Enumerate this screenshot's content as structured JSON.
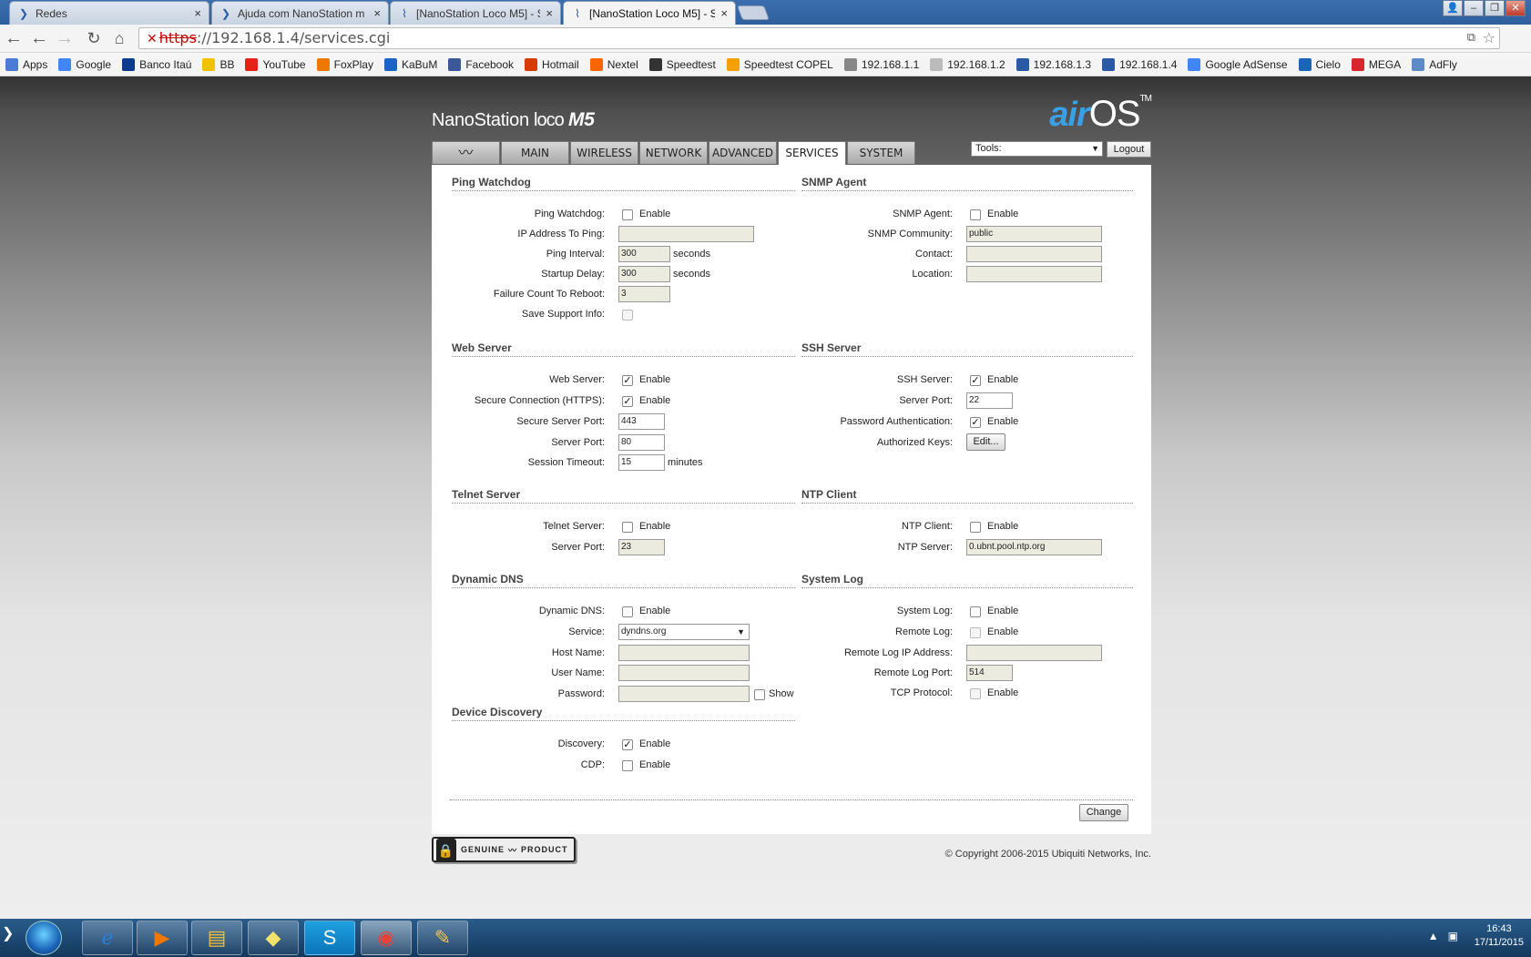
{
  "browser": {
    "tabs": [
      {
        "title": "Redes",
        "icon": "tab-generic-icon"
      },
      {
        "title": "Ajuda com NanoStation m",
        "icon": "tab-generic-icon"
      },
      {
        "title": "[NanoStation Loco M5] - S",
        "icon": "wifi-icon"
      },
      {
        "title": "[NanoStation Loco M5] - S",
        "icon": "wifi-icon"
      }
    ],
    "url": {
      "scheme": "https",
      "rest": "://192.168.1.4/services.cgi"
    },
    "bookmarks": [
      {
        "label": "Apps",
        "color": "#4b7bd6"
      },
      {
        "label": "Google",
        "color": "#4285f4"
      },
      {
        "label": "Banco Itaú",
        "color": "#0b3b8c"
      },
      {
        "label": "BB",
        "color": "#f2c200"
      },
      {
        "label": "YouTube",
        "color": "#e62117"
      },
      {
        "label": "FoxPlay",
        "color": "#f07800"
      },
      {
        "label": "KaBuM",
        "color": "#1a64c8"
      },
      {
        "label": "Facebook",
        "color": "#3b5998"
      },
      {
        "label": "Hotmail",
        "color": "#d83b01"
      },
      {
        "label": "Nextel",
        "color": "#ff6600"
      },
      {
        "label": "Speedtest",
        "color": "#333333"
      },
      {
        "label": "Speedtest COPEL",
        "color": "#f5a000"
      },
      {
        "label": "192.168.1.1",
        "color": "#888888"
      },
      {
        "label": "192.168.1.2",
        "color": "#bbbbbb"
      },
      {
        "label": "192.168.1.3",
        "color": "#2a5aa5"
      },
      {
        "label": "192.168.1.4",
        "color": "#2a5aa5"
      },
      {
        "label": "Google AdSense",
        "color": "#4285f4"
      },
      {
        "label": "Cielo",
        "color": "#1a66b8"
      },
      {
        "label": "MEGA",
        "color": "#d9272e"
      },
      {
        "label": "AdFly",
        "color": "#5b8bc8"
      }
    ]
  },
  "device": {
    "name_main": "NanoStation",
    "name_loco": "loco",
    "name_model": "M5",
    "brand_air": "air",
    "brand_os": "OS",
    "brand_tm": "TM"
  },
  "nav": {
    "tabs": [
      "MAIN",
      "WIRELESS",
      "NETWORK",
      "ADVANCED",
      "SERVICES",
      "SYSTEM"
    ],
    "active": "SERVICES",
    "tools": "Tools:",
    "logout": "Logout"
  },
  "ping": {
    "title": "Ping Watchdog",
    "watchdog_label": "Ping Watchdog:",
    "watchdog_enable": "Enable",
    "ip_label": "IP Address To Ping:",
    "ip_value": "",
    "interval_label": "Ping Interval:",
    "interval_value": "300",
    "interval_unit": "seconds",
    "delay_label": "Startup Delay:",
    "delay_value": "300",
    "delay_unit": "seconds",
    "failure_label": "Failure Count To Reboot:",
    "failure_value": "3",
    "support_label": "Save Support Info:"
  },
  "snmp": {
    "title": "SNMP Agent",
    "agent_label": "SNMP Agent:",
    "agent_enable": "Enable",
    "community_label": "SNMP Community:",
    "community_value": "public",
    "contact_label": "Contact:",
    "contact_value": "",
    "location_label": "Location:",
    "location_value": ""
  },
  "web": {
    "title": "Web Server",
    "server_label": "Web Server:",
    "server_enable": "Enable",
    "https_label": "Secure Connection (HTTPS):",
    "https_enable": "Enable",
    "secure_port_label": "Secure Server Port:",
    "secure_port_value": "443",
    "port_label": "Server Port:",
    "port_value": "80",
    "timeout_label": "Session Timeout:",
    "timeout_value": "15",
    "timeout_unit": "minutes"
  },
  "ssh": {
    "title": "SSH Server",
    "server_label": "SSH Server:",
    "server_enable": "Enable",
    "port_label": "Server Port:",
    "port_value": "22",
    "pwauth_label": "Password Authentication:",
    "pwauth_enable": "Enable",
    "keys_label": "Authorized Keys:",
    "keys_button": "Edit..."
  },
  "telnet": {
    "title": "Telnet Server",
    "server_label": "Telnet Server:",
    "server_enable": "Enable",
    "port_label": "Server Port:",
    "port_value": "23"
  },
  "ntp": {
    "title": "NTP Client",
    "client_label": "NTP Client:",
    "client_enable": "Enable",
    "server_label": "NTP Server:",
    "server_value": "0.ubnt.pool.ntp.org"
  },
  "ddns": {
    "title": "Dynamic DNS",
    "ddns_label": "Dynamic DNS:",
    "ddns_enable": "Enable",
    "service_label": "Service:",
    "service_value": "dyndns.org",
    "host_label": "Host Name:",
    "host_value": "",
    "user_label": "User Name:",
    "user_value": "",
    "password_label": "Password:",
    "password_value": "",
    "show_label": "Show"
  },
  "syslog": {
    "title": "System Log",
    "syslog_label": "System Log:",
    "syslog_enable": "Enable",
    "remote_label": "Remote Log:",
    "remote_enable": "Enable",
    "remote_ip_label": "Remote Log IP Address:",
    "remote_ip_value": "",
    "remote_port_label": "Remote Log Port:",
    "remote_port_value": "514",
    "tcp_label": "TCP Protocol:",
    "tcp_enable": "Enable"
  },
  "discovery": {
    "title": "Device Discovery",
    "discovery_label": "Discovery:",
    "discovery_enable": "Enable",
    "cdp_label": "CDP:",
    "cdp_enable": "Enable"
  },
  "actions": {
    "change": "Change"
  },
  "footer": {
    "genuine_left": "GENUINE",
    "genuine_right": "PRODUCT",
    "copyright": "© Copyright 2006-2015 Ubiquiti Networks, Inc."
  },
  "taskbar": {
    "time": "16:43",
    "date": "17/11/2015"
  }
}
